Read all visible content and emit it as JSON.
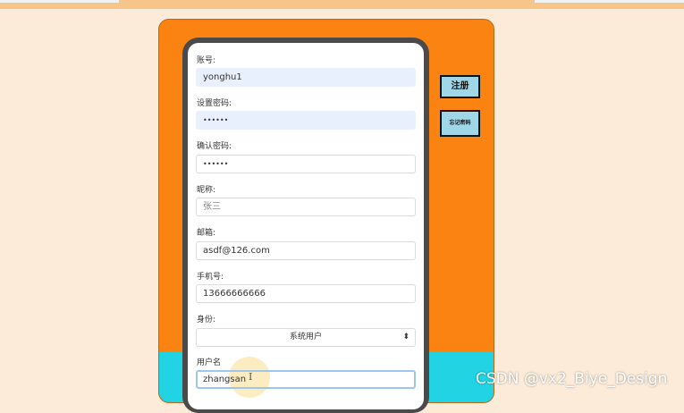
{
  "form": {
    "fields": [
      {
        "label": "账号:",
        "value": "yonghu1"
      },
      {
        "label": "设置密码:",
        "value": "••••••"
      },
      {
        "label": "确认密码:",
        "value": "••••••"
      },
      {
        "label": "昵称:",
        "placeholder": "张三"
      },
      {
        "label": "邮箱:",
        "value": "asdf@126.com"
      },
      {
        "label": "手机号:",
        "value": "13666666666"
      },
      {
        "label": "身份:",
        "selected": "系统用户"
      },
      {
        "label": "用户名",
        "value": "zhangsan"
      }
    ]
  },
  "buttons": {
    "register": "注册",
    "forgot_password": "忘记密码"
  },
  "watermark": "CSDN @vx2_Biye_Design",
  "icons": {
    "select_arrow": "up-down-arrows-icon",
    "text_cursor": "i-beam-cursor-icon"
  },
  "colors": {
    "page_bg": "#fbebd8",
    "panel_orange": "#fb8311",
    "band_cyan": "#21d3e3",
    "button_blue": "#9fd6e8"
  }
}
